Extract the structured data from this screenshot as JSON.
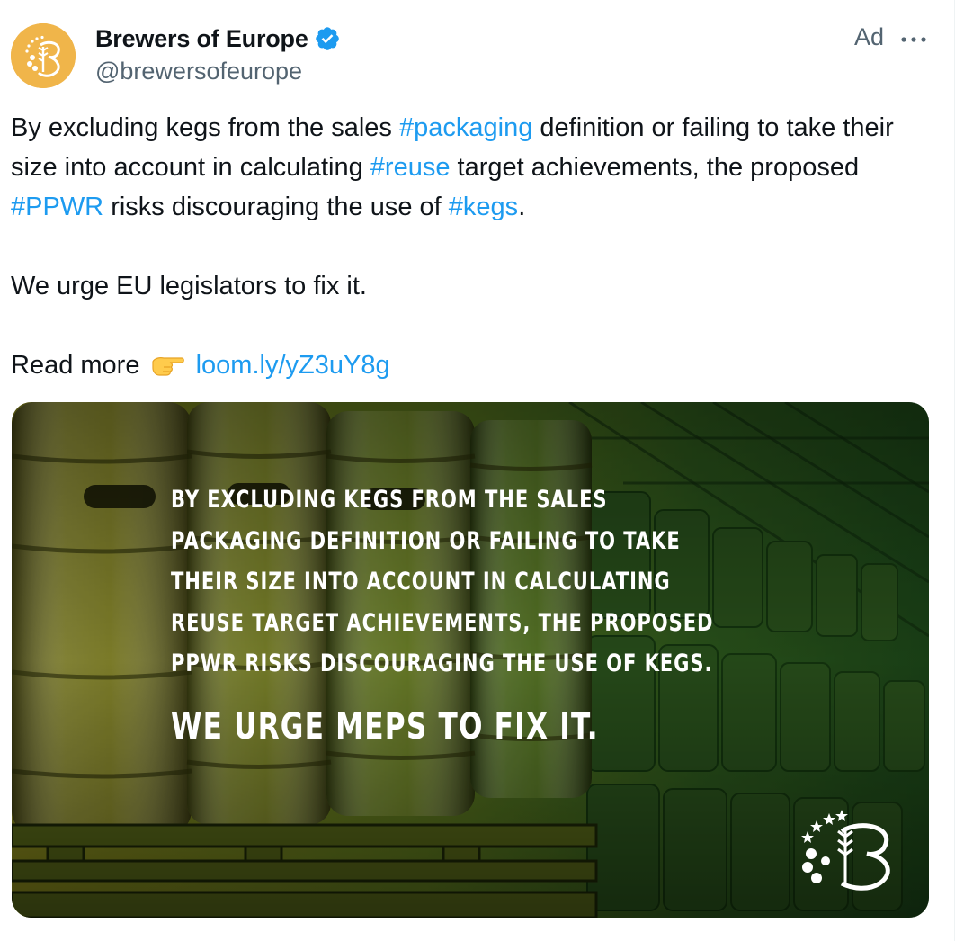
{
  "author": {
    "display_name": "Brewers of Europe",
    "handle": "@brewersofeurope",
    "verified": true,
    "avatar_icon": "brewers-of-europe-logo",
    "avatar_color": "#f0b54a"
  },
  "ad_label": "Ad",
  "more_icon": "ellipsis-icon",
  "tweet": {
    "p1": [
      {
        "text": "By excluding kegs from the sales ",
        "link": false
      },
      {
        "text": "#packaging",
        "link": true
      },
      {
        "text": " definition or failing to take their size into account in calculating ",
        "link": false
      },
      {
        "text": "#reuse",
        "link": true
      },
      {
        "text": " target achievements, the proposed ",
        "link": false
      },
      {
        "text": "#PPWR",
        "link": true
      },
      {
        "text": " risks discouraging the use of ",
        "link": false
      },
      {
        "text": "#kegs",
        "link": true
      },
      {
        "text": ".",
        "link": false
      }
    ],
    "p2": "We urge EU legislators to fix it.",
    "p3_prefix": "Read more",
    "p3_emoji": "backhand-index-pointing-right",
    "p3_link": "loom.ly/yZ3uY8g"
  },
  "media": {
    "body": "By excluding kegs from the sales\npackaging definition or failing to take\ntheir size into account in calculating\nreuse target achievements, the proposed\nPPWR risks discouraging the use of kegs.",
    "cta": "We urge MEPs to fix it.",
    "logo_icon": "brewers-of-europe-logo"
  },
  "colors": {
    "link": "#1d9bf0",
    "text": "#0f1419",
    "secondary": "#536471",
    "verified": "#1d9bf0"
  }
}
